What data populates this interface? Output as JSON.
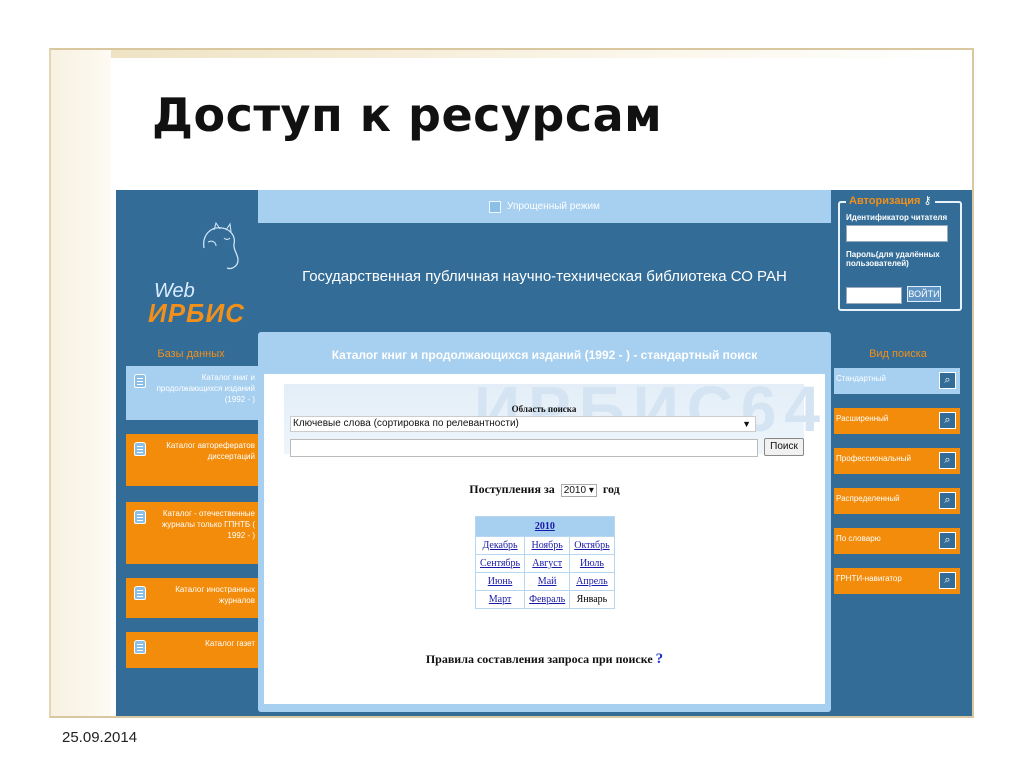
{
  "slide": {
    "title": "Доступ к ресурсам",
    "date": "25.09.2014"
  },
  "app": {
    "logo_web": "Web",
    "logo_irbis": "ИРБИС",
    "mode_label": "Упрощенный режим",
    "library_name": "Государственная публичная научно-техническая библиотека СО РАН"
  },
  "auth": {
    "legend": "Авторизация",
    "reader_id_label": "Идентификатор читателя",
    "password_label": "Пароль(для удалённых пользователей)",
    "login_button": "ВОЙТИ"
  },
  "databases": {
    "heading": "Базы данных",
    "items": [
      {
        "label": "Каталог книг и продолжающихся изданий (1992 - )"
      },
      {
        "label": "Каталог авторефератов диссертаций"
      },
      {
        "label": "Каталог - отечественные журналы только ГПНТБ ( 1992 - )"
      },
      {
        "label": "Каталог иностранных журналов"
      },
      {
        "label": "Каталог газет"
      }
    ]
  },
  "catalog": {
    "title": "Каталог книг и продолжающихся изданий (1992 - ) - стандартный поиск",
    "watermark": "ИРБИС64",
    "search_area_label": "Область поиска",
    "search_area_value": "Ключевые слова (сортировка по релевантности)",
    "search_button": "Поиск",
    "arrivals_prefix": "Поступления за",
    "arrivals_year": "2010",
    "arrivals_suffix": "год",
    "calendar": {
      "year": "2010",
      "months": [
        "Декабрь",
        "Ноябрь",
        "Октябрь",
        "Сентябрь",
        "Август",
        "Июль",
        "Июнь",
        "Май",
        "Апрель",
        "Март",
        "Февраль",
        "Январь"
      ]
    },
    "rules_text": "Правила составления запроса при поиске",
    "rules_mark": "?"
  },
  "search_types": {
    "heading": "Вид поиска",
    "items": [
      {
        "label": "Стандартный"
      },
      {
        "label": "Расширенный"
      },
      {
        "label": "Профессиональный"
      },
      {
        "label": "Распределенный"
      },
      {
        "label": "По словарю"
      },
      {
        "label": "ГРНТИ-навигатор"
      }
    ]
  },
  "colors": {
    "orange": "#f28c0a",
    "blue": "#326c97",
    "light_blue": "#a6cff0",
    "frame": "#d8c79f"
  },
  "icons": [
    "magnifier-icon",
    "database-icon",
    "key-icon",
    "monitor-icon"
  ]
}
